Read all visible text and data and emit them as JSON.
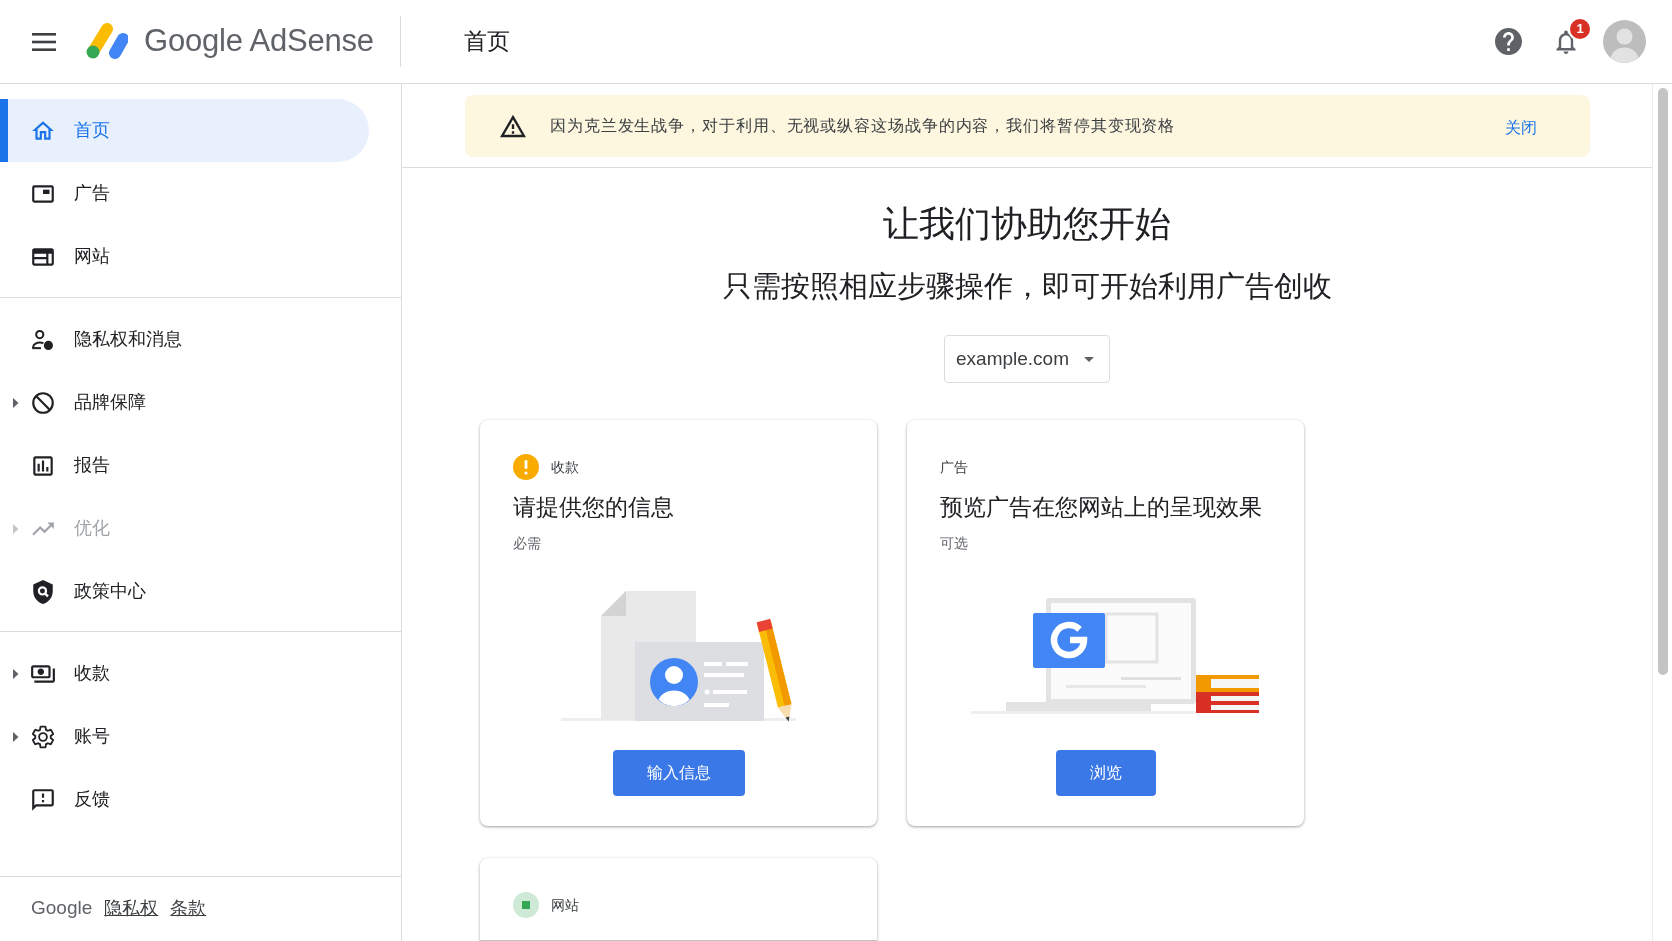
{
  "header": {
    "product_name": "Google AdSense",
    "page_title": "首页",
    "notification_count": "1"
  },
  "sidebar": {
    "groups": [
      {
        "items": [
          {
            "label": "首页",
            "kind": "home",
            "selected": true,
            "expandable": false,
            "disabled": false
          },
          {
            "label": "广告",
            "kind": "ads",
            "selected": false,
            "expandable": false,
            "disabled": false
          },
          {
            "label": "网站",
            "kind": "sites",
            "selected": false,
            "expandable": false,
            "disabled": false
          }
        ]
      },
      {
        "items": [
          {
            "label": "隐私权和消息",
            "kind": "privacy",
            "selected": false,
            "expandable": false,
            "disabled": false
          },
          {
            "label": "品牌保障",
            "kind": "brand-safety",
            "selected": false,
            "expandable": true,
            "disabled": false
          },
          {
            "label": "报告",
            "kind": "reports",
            "selected": false,
            "expandable": false,
            "disabled": false
          },
          {
            "label": "优化",
            "kind": "optimization",
            "selected": false,
            "expandable": true,
            "disabled": true
          },
          {
            "label": "政策中心",
            "kind": "policy",
            "selected": false,
            "expandable": false,
            "disabled": false
          }
        ]
      },
      {
        "items": [
          {
            "label": "收款",
            "kind": "payments",
            "selected": false,
            "expandable": true,
            "disabled": false
          },
          {
            "label": "账号",
            "kind": "account",
            "selected": false,
            "expandable": true,
            "disabled": false
          },
          {
            "label": "反馈",
            "kind": "feedback",
            "selected": false,
            "expandable": false,
            "disabled": false
          }
        ]
      }
    ],
    "footer": {
      "brand": "Google",
      "links": [
        "隐私权",
        "条款"
      ]
    }
  },
  "banner": {
    "message": "因为克兰发生战争，对于利用、无视或纵容这场战争的内容，我们将暂停其变现资格",
    "dismiss": "关闭"
  },
  "intro": {
    "title": "让我们协助您开始",
    "subtitle": "只需按照相应步骤操作，即可开始利用广告创收"
  },
  "site_selector": {
    "value": "example.com"
  },
  "cards": [
    {
      "kind": "info",
      "needs_action": true,
      "done": false,
      "category": "收款",
      "title": "请提供您的信息",
      "requirement": "必需",
      "button": "输入信息"
    },
    {
      "kind": "preview",
      "needs_action": false,
      "done": false,
      "category": "广告",
      "title": "预览广告在您网站上的呈现效果",
      "requirement": "可选",
      "button": "浏览"
    },
    {
      "kind": "site",
      "needs_action": false,
      "done": true,
      "category": "网站"
    }
  ]
}
